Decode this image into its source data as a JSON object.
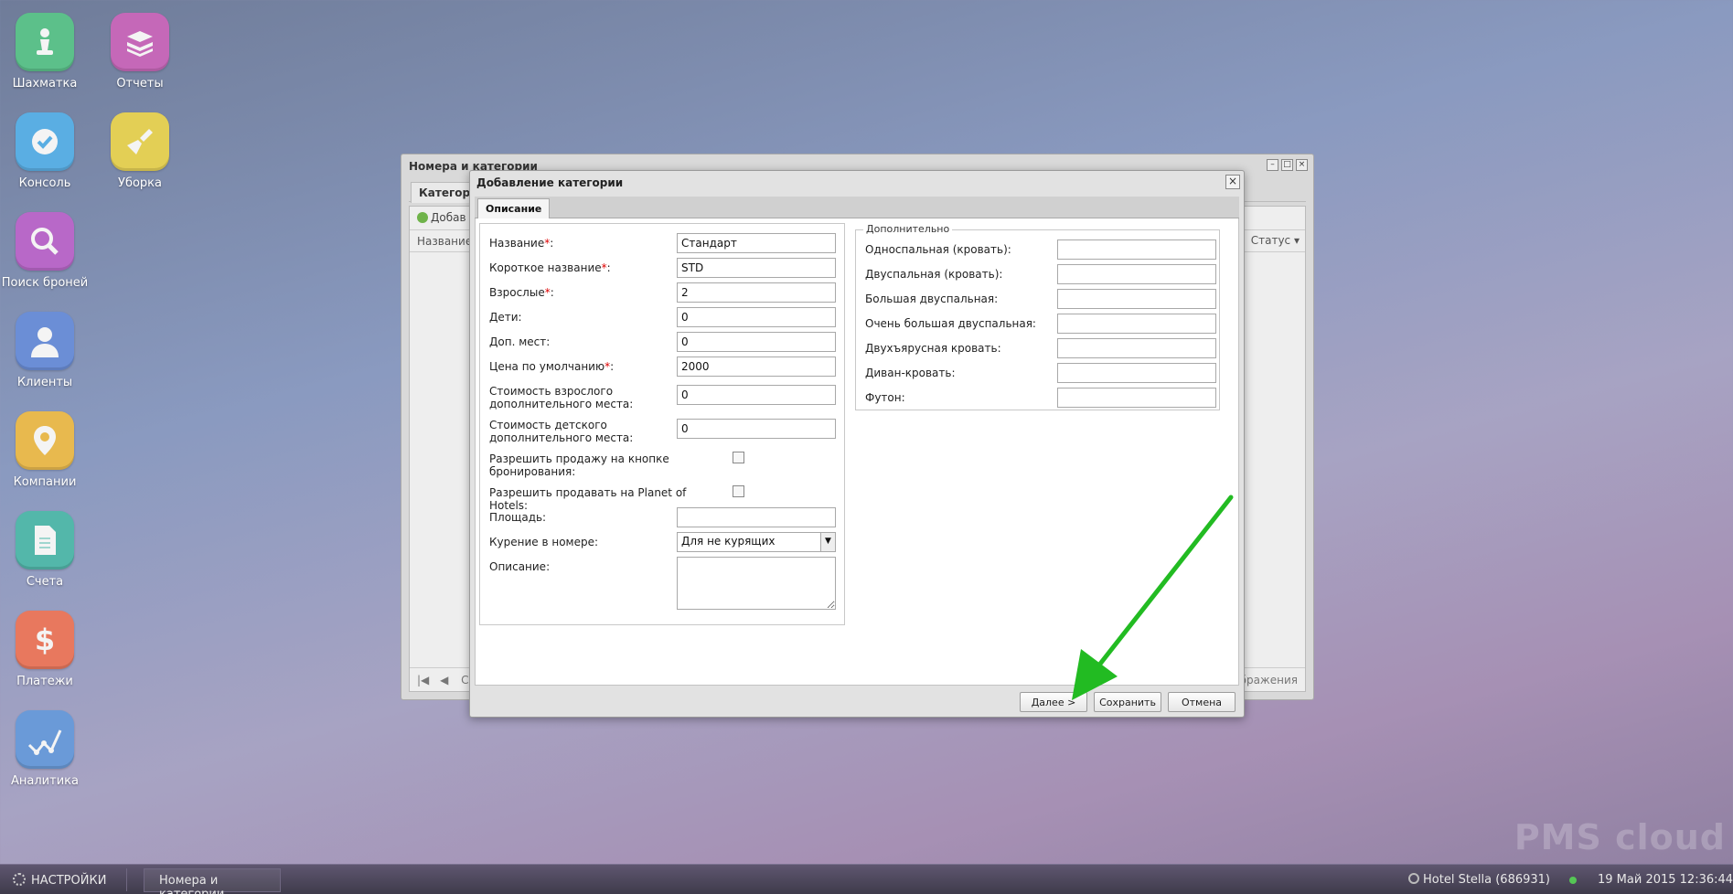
{
  "desktop": {
    "icons": [
      {
        "label": "Шахматка",
        "icon": "chess-pawn-icon",
        "color": "#5cc08a"
      },
      {
        "label": "Отчеты",
        "icon": "books-icon",
        "color": "#c568b8"
      },
      {
        "label": "Консоль",
        "icon": "checkmark-icon",
        "color": "#5aaee3"
      },
      {
        "label": "Уборка",
        "icon": "broom-icon",
        "color": "#e3cf55"
      },
      {
        "label": "Поиск броней",
        "icon": "magnifier-icon",
        "color": "#b868c8"
      },
      {
        "label": "Клиенты",
        "icon": "user-icon",
        "color": "#6b8ed6"
      },
      {
        "label": "Компании",
        "icon": "map-pin-icon",
        "color": "#e8b94e"
      },
      {
        "label": "Счета",
        "icon": "document-icon",
        "color": "#53b7aa"
      },
      {
        "label": "Платежи",
        "icon": "dollar-icon",
        "color": "#e8785e"
      },
      {
        "label": "Аналитика",
        "icon": "chart-line-icon",
        "color": "#6a9ad8"
      }
    ]
  },
  "bg_window": {
    "title": "Номера и категории",
    "tab": "Категори",
    "toolbar_add": "Добав",
    "col_name": "Название",
    "col_status": "Статус",
    "pager_right": "ображения",
    "pager_left": "С"
  },
  "dialog": {
    "title": "Добавление категории",
    "tab": "Описание",
    "fields": {
      "name": {
        "label": "Название",
        "suffix": ":",
        "value": "Стандарт"
      },
      "short_name": {
        "label": "Короткое название",
        "suffix": ":",
        "value": "STD"
      },
      "adults": {
        "label": "Взрослые",
        "suffix": ":",
        "value": "2"
      },
      "children": {
        "label": "Дети:",
        "value": "0"
      },
      "extra_beds": {
        "label": "Доп. мест:",
        "value": "0"
      },
      "default_price": {
        "label": "Цена по умолчанию",
        "suffix": ":",
        "value": "2000"
      },
      "adult_extra_cost": {
        "label_line1": "Стоимость взрослого",
        "label_line2": "дополнительного места:",
        "value": "0"
      },
      "child_extra_cost": {
        "label_line1": "Стоимость детского",
        "label_line2": "дополнительного места:",
        "value": "0"
      },
      "allow_booking_button": {
        "label_line1": "Разрешить продажу на кнопке",
        "label_line2": "бронирования:"
      },
      "allow_planet": {
        "label": "Разрешить продавать на Planet of Hotels:"
      },
      "area": {
        "label": "Площадь:",
        "value": ""
      },
      "smoking": {
        "label": "Курение в номере:",
        "value": "Для не курящих"
      },
      "description": {
        "label": "Описание:",
        "value": ""
      }
    },
    "extra": {
      "legend": "Дополнительно",
      "single_bed": "Односпальная (кровать):",
      "double_bed": "Двуспальная (кровать):",
      "large_double": "Большая двуспальная:",
      "xl_double": "Очень большая двуспальная:",
      "bunk_bed": "Двухъярусная кровать:",
      "sofa_bed": "Диван-кровать:",
      "futon": "Футон:"
    },
    "buttons": {
      "next": "Далее >",
      "save": "Сохранить",
      "cancel": "Отмена"
    }
  },
  "watermark": "PMS cloud",
  "taskbar": {
    "settings": "НАСТРОЙКИ",
    "task": "Номера и категории",
    "hotel": "Hotel Stella (686931)",
    "datetime": "19 Май 2015 12:36:44"
  },
  "colors": {
    "arrow": "#22bb22",
    "required": "#dd0000"
  }
}
